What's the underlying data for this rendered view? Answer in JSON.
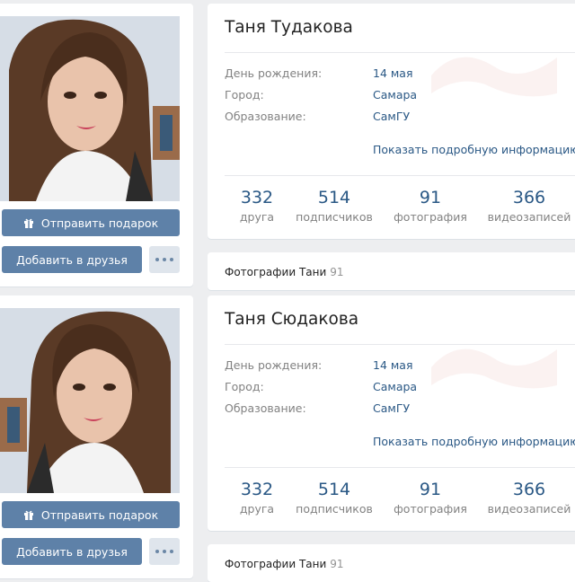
{
  "profiles": [
    {
      "name": "Таня Тудакова",
      "info": [
        {
          "label": "День рождения:",
          "value": "14 мая"
        },
        {
          "label": "Город:",
          "value": "Самара"
        },
        {
          "label": "Образование:",
          "value": "СамГУ"
        }
      ],
      "more_info": "Показать подробную информацию",
      "counters": [
        {
          "num": "332",
          "cap": "друга"
        },
        {
          "num": "514",
          "cap": "подписчиков"
        },
        {
          "num": "91",
          "cap": "фотография"
        },
        {
          "num": "366",
          "cap": "видеозаписей"
        }
      ],
      "gift_button": "Отправить подарок",
      "add_friend_button": "Добавить в друзья",
      "photos_title": "Фотографии Тани",
      "photos_count": "91"
    },
    {
      "name": "Таня Сюдакова",
      "info": [
        {
          "label": "День рождения:",
          "value": "14 мая"
        },
        {
          "label": "Город:",
          "value": "Самара"
        },
        {
          "label": "Образование:",
          "value": "СамГУ"
        }
      ],
      "more_info": "Показать подробную информацию",
      "counters": [
        {
          "num": "332",
          "cap": "друга"
        },
        {
          "num": "514",
          "cap": "подписчиков"
        },
        {
          "num": "91",
          "cap": "фотография"
        },
        {
          "num": "366",
          "cap": "видеозаписей"
        }
      ],
      "gift_button": "Отправить подарок",
      "add_friend_button": "Добавить в друзья",
      "photos_title": "Фотографии Тани",
      "photos_count": "91"
    }
  ],
  "colors": {
    "background": "#edeef0",
    "button": "#5e81a8",
    "link": "#2a5885",
    "muted": "#828282"
  }
}
